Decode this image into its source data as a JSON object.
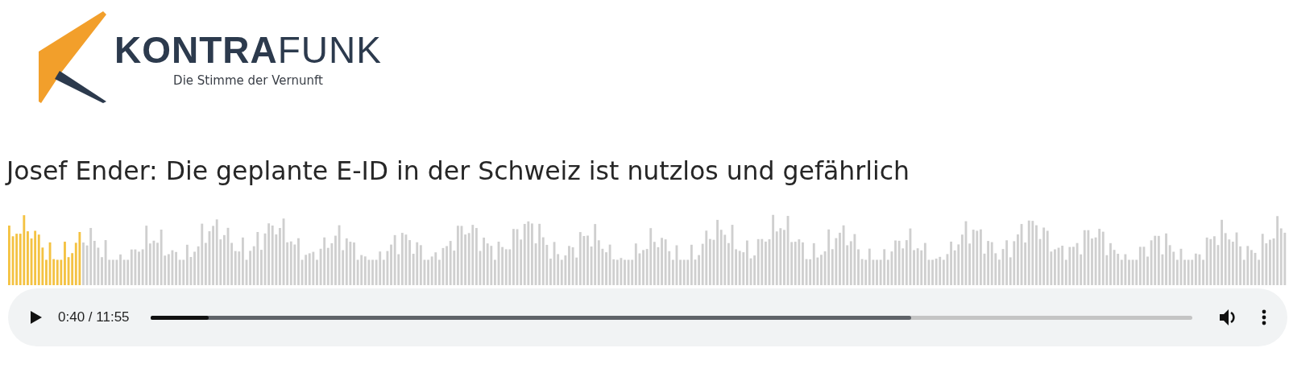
{
  "logo": {
    "wordmark": "**KONTRA**FUNK",
    "tagline": "Die Stimme der Vernunft"
  },
  "title": "Josef Ender: Die geplante E-ID in der Schweiz ist nutzlos und gefährlich",
  "player": {
    "time": "0:40 / 11:55",
    "progress": {
      "level": 0.056
    },
    "buffer": {
      "level": 0.73
    }
  }
}
